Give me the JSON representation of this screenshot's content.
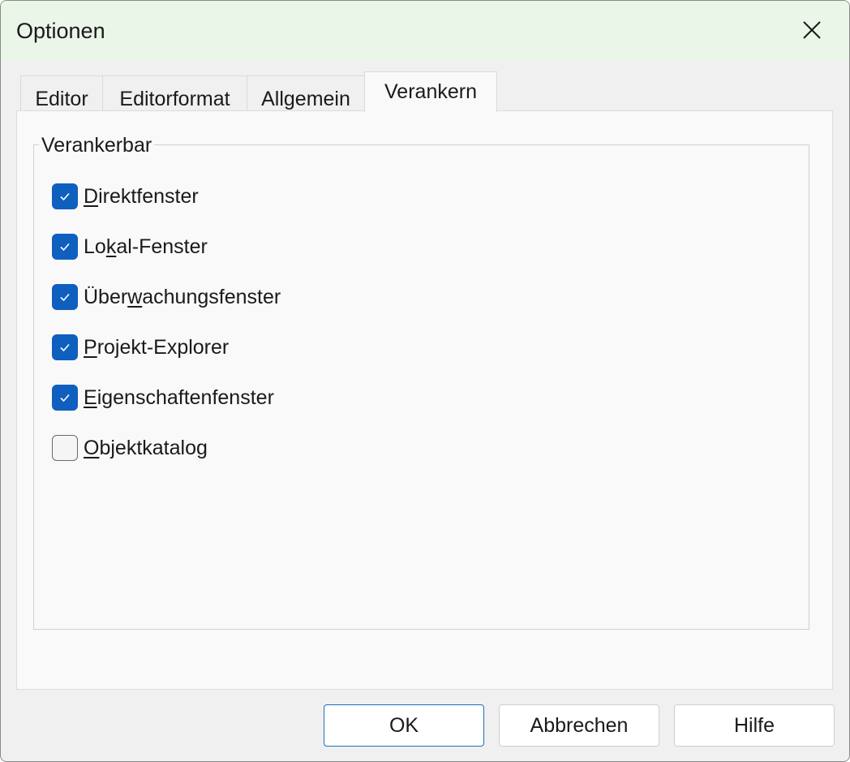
{
  "window": {
    "title": "Optionen"
  },
  "tabs": [
    {
      "label": "Editor",
      "active": false
    },
    {
      "label": "Editorformat",
      "active": false
    },
    {
      "label": "Allgemein",
      "active": false
    },
    {
      "label": "Verankern",
      "active": true
    }
  ],
  "group": {
    "label": "Verankerbar",
    "items": [
      {
        "pre": "",
        "key": "D",
        "post": "irektfenster",
        "checked": true
      },
      {
        "pre": "Lo",
        "key": "k",
        "post": "al-Fenster",
        "checked": true
      },
      {
        "pre": "Über",
        "key": "w",
        "post": "achungsfenster",
        "checked": true
      },
      {
        "pre": "",
        "key": "P",
        "post": "rojekt-Explorer",
        "checked": true
      },
      {
        "pre": "",
        "key": "E",
        "post": "igenschaftenfenster",
        "checked": true
      },
      {
        "pre": "",
        "key": "O",
        "post": "bjektkatalog",
        "checked": false
      }
    ]
  },
  "buttons": {
    "ok": "OK",
    "cancel": "Abbrechen",
    "help": "Hilfe"
  },
  "icons": {
    "close": "close-icon",
    "check": "checkmark-icon"
  },
  "colors": {
    "titlebar": "#eaf6e8",
    "accent": "#0f5fbf",
    "panel": "#f9f9f9",
    "dialog": "#f0f0f0"
  }
}
